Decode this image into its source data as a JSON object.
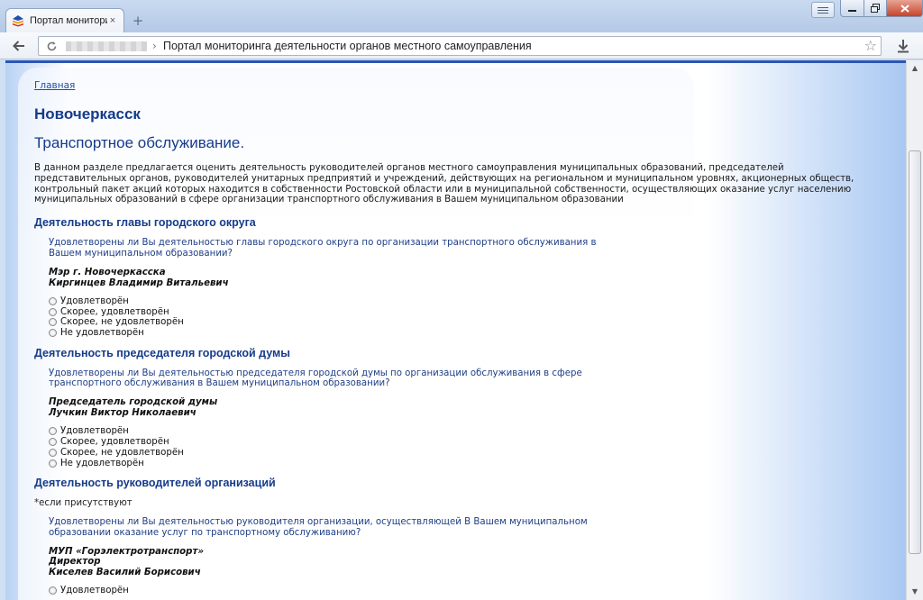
{
  "browser": {
    "tab_title": "Портал мониторинга",
    "tab_close": "×",
    "new_tab": "+",
    "address_title": "Портал мониторинга деятельности органов местного самоуправления",
    "address_separator": "›",
    "icons": {
      "back": "arrow-left-icon",
      "reload": "reload-icon",
      "star": "star-icon",
      "download": "download-icon",
      "menu": "menu-icon"
    }
  },
  "page": {
    "breadcrumb": "Главная",
    "city": "Новочеркасск",
    "section_title": "Транспортное обслуживание.",
    "intro": "В данном разделе предлагается оценить деятельность руководителей органов местного самоуправления муниципальных образований, председателей представительных органов, руководителей унитарных предприятий и учреждений, действующих на региональном и муниципальном уровнях, акционерных обществ, контрольный пакет акций которых находится в собственности Ростовской области или в муниципальной собственности, осуществляющих оказание услуг населению муниципальных образований в сфере организации транспортного обслуживания в Вашем муниципальном образовании",
    "blocks": [
      {
        "heading": "Деятельность главы городского округа",
        "question": "Удовлетворены ли Вы деятельностью главы городского округа по организации транспортного обслуживания в Вашем муниципальном образовании?",
        "person_line1": "Мэр г. Новочеркасска",
        "person_line2": "Киргинцев Владимир Витальевич"
      },
      {
        "heading": "Деятельность председателя городской думы",
        "question": "Удовлетворены ли Вы деятельностью председателя городской думы по организации обслуживания в сфере транспортного обслуживания в Вашем муниципальном образовании?",
        "person_line1": "Председатель городской думы",
        "person_line2": "Лучкин Виктор Николаевич"
      },
      {
        "heading": "Деятельность руководителей организаций",
        "note": "*если присутствуют",
        "question": "Удовлетворены ли Вы деятельностью руководителя организации, осуществляющей В Вашем муниципальном образовании оказание услуг по транспортному обслуживанию?",
        "person_line1": "МУП «Горэлектротранспорт»",
        "person_line2": "Директор",
        "person_line3": "Киселев Василий Борисович"
      }
    ],
    "options": [
      "Удовлетворён",
      "Скорее, удовлетворён",
      "Скорее, не удовлетворён",
      "Не удовлетворён"
    ]
  },
  "colors": {
    "heading": "#153b8a",
    "link": "#1e4fa3",
    "accent_line": "#2a56b4"
  }
}
